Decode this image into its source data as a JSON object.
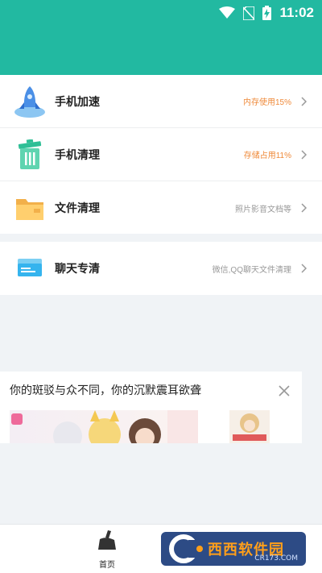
{
  "status_bar": {
    "time": "11:02"
  },
  "main_list": [
    {
      "label": "手机加速",
      "value": "内存使用15%",
      "accent": true,
      "icon": "rocket-icon"
    },
    {
      "label": "手机清理",
      "value": "存储占用11%",
      "accent": true,
      "icon": "trash-can-icon"
    },
    {
      "label": "文件清理",
      "value": "照片影音文档等",
      "accent": false,
      "icon": "folder-icon"
    }
  ],
  "chat_item": {
    "label": "聊天专清",
    "value": "微信,QQ聊天文件清理",
    "icon": "chat-card-icon"
  },
  "ad": {
    "title": "你的斑驳与众不同，你的沉默震耳欲聋"
  },
  "tabbar": {
    "home_label": "首页"
  },
  "watermark": {
    "text": "西西软件园",
    "sub": "CR173.COM"
  },
  "colors": {
    "header": "#22b9a1",
    "accent": "#ef8a3a"
  }
}
